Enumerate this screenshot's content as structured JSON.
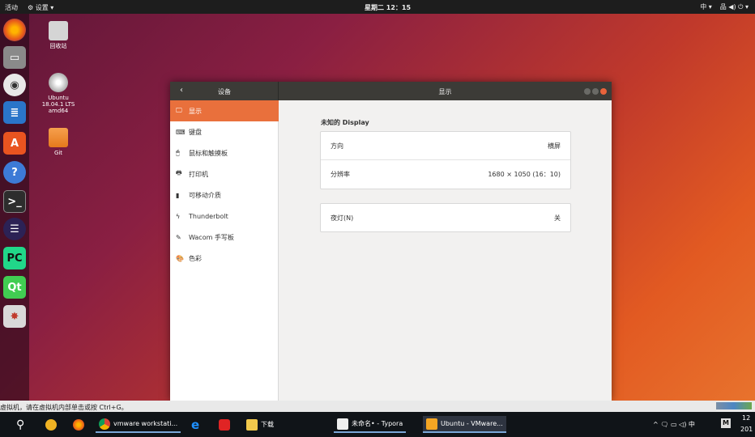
{
  "topbar": {
    "activities": "活动",
    "app_menu": "⚙ 设置 ▾",
    "clock": "星期二 12：15",
    "input_method": "中 ▾",
    "status_icons": "品 ◀) ⏻ ▾"
  },
  "desktop": {
    "trash_label": "回收站",
    "dvd_label": "Ubuntu 18.04.1 LTS amd64",
    "git_label": "Git"
  },
  "dock": {
    "items": [
      "firefox",
      "files",
      "rhythmbox",
      "writer",
      "software",
      "help",
      "terminal",
      "eclipse",
      "pycharm",
      "qt",
      "settings"
    ]
  },
  "window": {
    "back_title": "设备",
    "main_title": "显示",
    "sidebar": [
      {
        "icon": "🖵",
        "label": "显示"
      },
      {
        "icon": "⌨",
        "label": "键盘"
      },
      {
        "icon": "🖱",
        "label": "鼠标和触摸板"
      },
      {
        "icon": "🖶",
        "label": "打印机"
      },
      {
        "icon": "▮",
        "label": "可移动介质"
      },
      {
        "icon": "ϟ",
        "label": "Thunderbolt"
      },
      {
        "icon": "✎",
        "label": "Wacom 手写板"
      },
      {
        "icon": "🎨",
        "label": "色彩"
      }
    ],
    "display_name": "未知的 Display",
    "orientation_label": "方向",
    "orientation_value": "横屏",
    "resolution_label": "分辨率",
    "resolution_value": "1680 × 1050 (16：10)",
    "nightlight_label": "夜灯(N)",
    "nightlight_value": "关"
  },
  "statusbar": {
    "text": "虚拟机，请在虚拟机内部单击或按 Ctrl+G。"
  },
  "taskbar": {
    "chrome_label": "vmware workstati...",
    "downloads_label": "下载",
    "typora_label": "未命名• - Typora",
    "vmware_label": "Ubuntu - VMware...",
    "tray_text": "^ 🗨 ▭ ◁) 中",
    "time_text": "12",
    "date_text": "201"
  }
}
